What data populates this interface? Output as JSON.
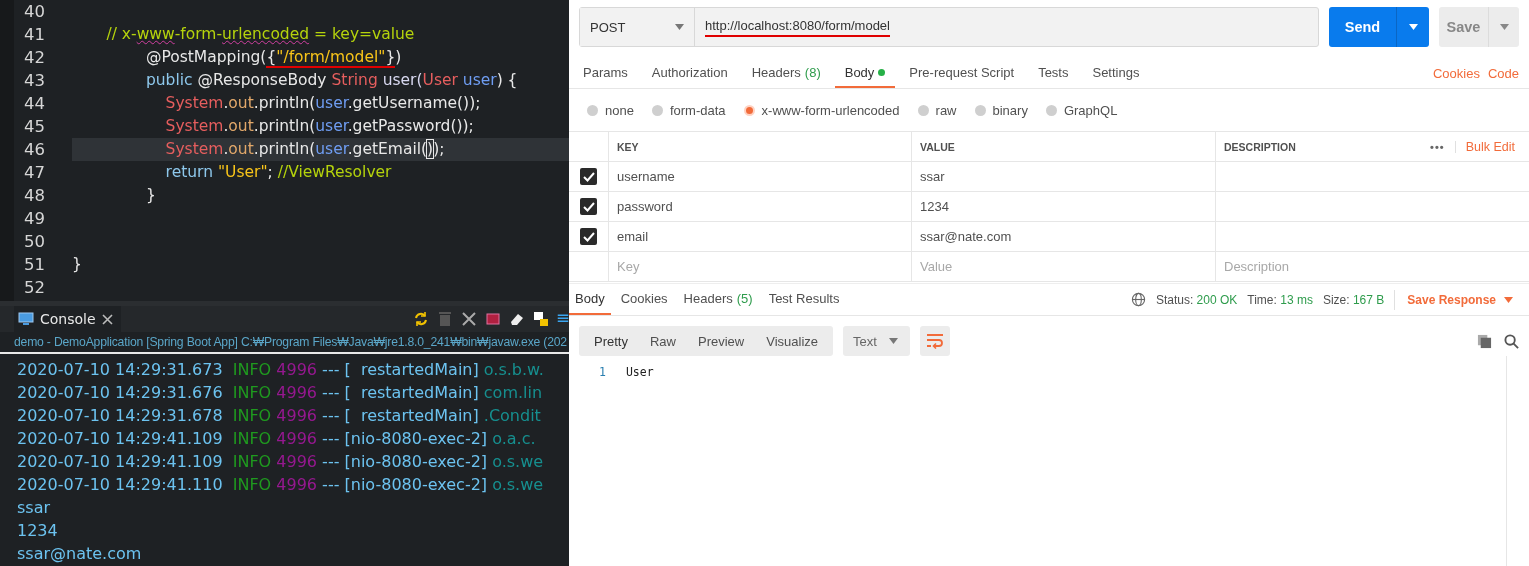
{
  "editor": {
    "lines": [
      {
        "number": "40",
        "current": false
      },
      {
        "number": "41",
        "current": false,
        "tokens": [
          {
            "kind": "comment",
            "text": "       // x-"
          },
          {
            "kind": "comment",
            "text": "www",
            "spell_error": true
          },
          {
            "kind": "comment",
            "text": "-form-"
          },
          {
            "kind": "comment",
            "text": "urlencoded",
            "spell_error": true
          },
          {
            "kind": "comment",
            "text": " = key=value"
          }
        ]
      },
      {
        "number": "42",
        "current": false,
        "tokens": [
          {
            "kind": "plain",
            "text": "               @PostMapping("
          },
          {
            "kind": "plain",
            "text": "{",
            "underlined": true
          },
          {
            "kind": "string",
            "text": "\"/form/model\"",
            "underlined": true
          },
          {
            "kind": "plain",
            "text": "}",
            "underlined": true
          },
          {
            "kind": "plain",
            "text": ")"
          }
        ]
      },
      {
        "number": "43",
        "current": false,
        "tokens": [
          {
            "kind": "keyword",
            "text": "               public"
          },
          {
            "kind": "plain",
            "text": " @ResponseBody "
          },
          {
            "kind": "type",
            "text": "String"
          },
          {
            "kind": "method",
            "text": " user("
          },
          {
            "kind": "type",
            "text": "User"
          },
          {
            "kind": "variable",
            "text": " user"
          },
          {
            "kind": "plain",
            "text": ") {"
          }
        ]
      },
      {
        "number": "44",
        "current": false,
        "tokens": [
          {
            "kind": "type",
            "text": "                   System"
          },
          {
            "kind": "plain",
            "text": "."
          },
          {
            "kind": "field",
            "text": "out"
          },
          {
            "kind": "plain",
            "text": ".println("
          },
          {
            "kind": "variable",
            "text": "user"
          },
          {
            "kind": "plain",
            "text": ".getUsername());"
          }
        ]
      },
      {
        "number": "45",
        "current": false,
        "tokens": [
          {
            "kind": "type",
            "text": "                   System"
          },
          {
            "kind": "plain",
            "text": "."
          },
          {
            "kind": "field",
            "text": "out"
          },
          {
            "kind": "plain",
            "text": ".println("
          },
          {
            "kind": "variable",
            "text": "user"
          },
          {
            "kind": "plain",
            "text": ".getPassword());"
          }
        ]
      },
      {
        "number": "46",
        "current": true,
        "tokens": [
          {
            "kind": "type",
            "text": "                   System"
          },
          {
            "kind": "plain",
            "text": "."
          },
          {
            "kind": "field",
            "text": "out"
          },
          {
            "kind": "plain",
            "text": ".println("
          },
          {
            "kind": "variable",
            "text": "user"
          },
          {
            "kind": "plain",
            "text": ".getEmail("
          },
          {
            "kind": "plain",
            "text": ")",
            "bracket_match": true
          },
          {
            "kind": "plain",
            "text": ");"
          }
        ]
      },
      {
        "number": "47",
        "current": false,
        "tokens": [
          {
            "kind": "keyword",
            "text": "                   return"
          },
          {
            "kind": "string",
            "text": " \"User\""
          },
          {
            "kind": "plain",
            "text": "; "
          },
          {
            "kind": "comment",
            "text": "//ViewResolver"
          }
        ]
      },
      {
        "number": "48",
        "current": false,
        "tokens": [
          {
            "kind": "plain",
            "text": "               }"
          }
        ]
      },
      {
        "number": "49",
        "current": false
      },
      {
        "number": "50",
        "current": false
      },
      {
        "number": "51",
        "current": false,
        "tokens": [
          {
            "kind": "plain",
            "text": "}"
          }
        ]
      },
      {
        "number": "52",
        "current": false
      }
    ]
  },
  "console": {
    "tab": "Console",
    "launch": "demo - DemoApplication [Spring Boot App] C:₩Program Files₩Java₩jre1.8.0_241₩bin₩javaw.exe (202",
    "lines": [
      [
        {
          "kind": "time",
          "text": "2020-07-10 14:29:31.673 "
        },
        {
          "kind": "level",
          "text": " INFO "
        },
        {
          "kind": "pid",
          "text": "4996 "
        },
        {
          "kind": "sep",
          "text": "--- [  restartedMain] "
        },
        {
          "kind": "logger",
          "text": "o.s.b.w."
        }
      ],
      [
        {
          "kind": "time",
          "text": "2020-07-10 14:29:31.676 "
        },
        {
          "kind": "level",
          "text": " INFO "
        },
        {
          "kind": "pid",
          "text": "4996 "
        },
        {
          "kind": "sep",
          "text": "--- [  restartedMain] "
        },
        {
          "kind": "logger",
          "text": "com.lin"
        }
      ],
      [
        {
          "kind": "time",
          "text": "2020-07-10 14:29:31.678 "
        },
        {
          "kind": "level",
          "text": " INFO "
        },
        {
          "kind": "pid",
          "text": "4996 "
        },
        {
          "kind": "sep",
          "text": "--- [  restartedMain] "
        },
        {
          "kind": "logger",
          "text": ".Condit"
        }
      ],
      [
        {
          "kind": "time",
          "text": "2020-07-10 14:29:41.109 "
        },
        {
          "kind": "level",
          "text": " INFO "
        },
        {
          "kind": "pid",
          "text": "4996 "
        },
        {
          "kind": "sep",
          "text": "--- [nio-8080-exec-2] "
        },
        {
          "kind": "logger",
          "text": "o.a.c."
        }
      ],
      [
        {
          "kind": "time",
          "text": "2020-07-10 14:29:41.109 "
        },
        {
          "kind": "level",
          "text": " INFO "
        },
        {
          "kind": "pid",
          "text": "4996 "
        },
        {
          "kind": "sep",
          "text": "--- [nio-8080-exec-2] "
        },
        {
          "kind": "logger",
          "text": "o.s.we"
        }
      ],
      [
        {
          "kind": "time",
          "text": "2020-07-10 14:29:41.110 "
        },
        {
          "kind": "level",
          "text": " INFO "
        },
        {
          "kind": "pid",
          "text": "4996 "
        },
        {
          "kind": "sep",
          "text": "--- [nio-8080-exec-2] "
        },
        {
          "kind": "logger",
          "text": "o.s.we"
        }
      ],
      [
        {
          "kind": "time",
          "text": "ssar"
        }
      ],
      [
        {
          "kind": "time",
          "text": "1234"
        }
      ],
      [
        {
          "kind": "time",
          "text": "ssar@nate.com"
        }
      ]
    ]
  },
  "request": {
    "method": "POST",
    "url": "http://localhost:8080/form/model",
    "url_underlined": true,
    "send": "Send",
    "save": "Save",
    "tabs": [
      {
        "label": "Params",
        "selected": false
      },
      {
        "label": "Authorization",
        "selected": false
      },
      {
        "label": "Headers",
        "count": "(8)",
        "selected": false
      },
      {
        "label": "Body",
        "dot": true,
        "selected": true
      },
      {
        "label": "Pre-request Script",
        "selected": false
      },
      {
        "label": "Tests",
        "selected": false
      },
      {
        "label": "Settings",
        "selected": false
      }
    ],
    "links": [
      "Cookies",
      "Code"
    ],
    "body_types": [
      {
        "label": "none",
        "selected": false
      },
      {
        "label": "form-data",
        "selected": false
      },
      {
        "label": "x-www-form-urlencoded",
        "selected": true
      },
      {
        "label": "raw",
        "selected": false
      },
      {
        "label": "binary",
        "selected": false
      },
      {
        "label": "GraphQL",
        "selected": false
      }
    ],
    "table": {
      "columns": [
        "KEY",
        "VALUE",
        "DESCRIPTION"
      ],
      "more": "•••",
      "bulk_edit": "Bulk Edit",
      "rows": [
        {
          "checked": true,
          "key": "username",
          "value": "ssar"
        },
        {
          "checked": true,
          "key": "password",
          "value": "1234"
        },
        {
          "checked": true,
          "key": "email",
          "value": "ssar@nate.com"
        }
      ],
      "placeholders": [
        "Key",
        "Value",
        "Description"
      ]
    }
  },
  "response": {
    "tabs": [
      {
        "label": "Body",
        "selected": true
      },
      {
        "label": "Cookies",
        "selected": false
      },
      {
        "label": "Headers",
        "count": "(5)",
        "selected": false
      },
      {
        "label": "Test Results",
        "selected": false
      }
    ],
    "status": [
      {
        "label": "Status:",
        "value": "200 OK"
      },
      {
        "label": "Time:",
        "value": "13 ms"
      },
      {
        "label": "Size:",
        "value": "167 B"
      }
    ],
    "save_response": "Save Response",
    "views": [
      {
        "label": "Pretty",
        "selected": true
      },
      {
        "label": "Raw",
        "selected": false
      },
      {
        "label": "Preview",
        "selected": false
      },
      {
        "label": "Visualize",
        "selected": false
      }
    ],
    "format": "Text",
    "body_lines": [
      {
        "number": "1",
        "text": "User"
      }
    ]
  }
}
